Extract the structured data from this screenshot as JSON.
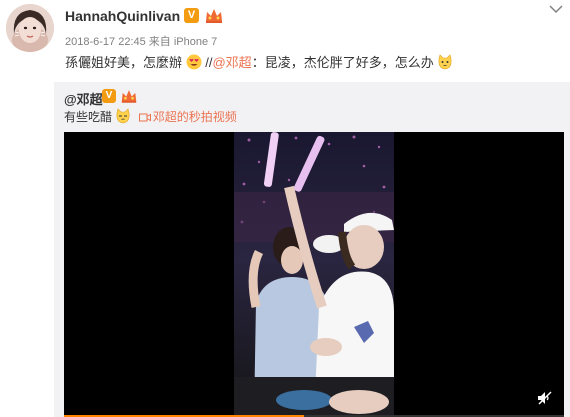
{
  "post": {
    "username": "HannahQuinlivan",
    "verified_badge": "V",
    "meta": "2018-6-17 22:45 来自 iPhone 7",
    "text_before": "孫儷姐好美，怎麼辦",
    "text_sep": " //",
    "mention": "@邓超",
    "text_after": "：昆凌，杰伦胖了好多，怎么办",
    "icons": [
      "avatar",
      "verified-v-icon",
      "vip-crown-icon",
      "chevron-down-icon",
      "heart-eyes-emoji",
      "cat-emoji"
    ]
  },
  "repost": {
    "username": "@邓超",
    "verified_badge": "V",
    "text": "有些吃醋",
    "video_link": "邓超的秒拍视频",
    "icons": [
      "cat-emoji",
      "video-camera-icon",
      "mute-icon"
    ]
  },
  "video": {
    "progress_fraction": 0.48,
    "accent": "#ff8200"
  },
  "colors": {
    "mention": "#eb7350",
    "badge": "#f39c12",
    "repost_bg": "#f2f2f5",
    "meta": "#808080"
  }
}
